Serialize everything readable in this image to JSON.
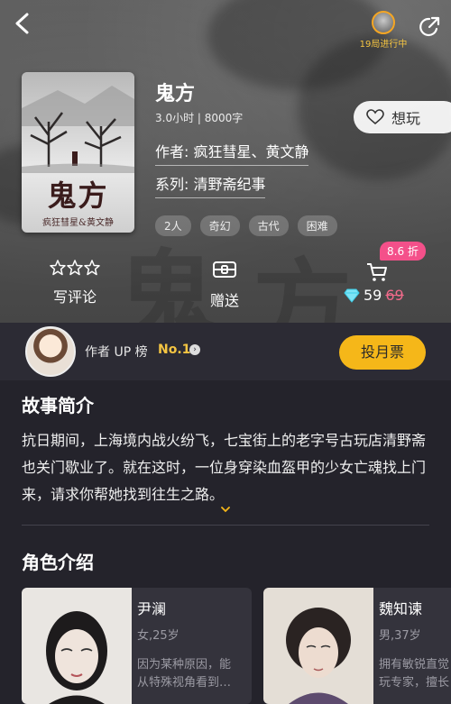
{
  "header": {
    "progress_text": "19局进行中"
  },
  "book": {
    "cover_title": "鬼方",
    "cover_authors": "疯狂彗星&黄文静",
    "title": "鬼方",
    "meta": "3.0小时 | 8000字",
    "author_line": "作者: 疯狂彗星、黄文静",
    "series_line": "系列: 清野斋纪事",
    "want_label": "想玩",
    "tags": [
      "2人",
      "奇幻",
      "古代",
      "困难"
    ]
  },
  "actions": {
    "review_label": "写评论",
    "gift_label": "赠送",
    "discount_badge": "8.6 折",
    "price_current": "59",
    "price_original": "69"
  },
  "up": {
    "label": "作者 UP 榜",
    "rank": "No.1",
    "vote_label": "投月票"
  },
  "story": {
    "heading": "故事简介",
    "text": "抗日期间，上海境内战火纷飞，七宝街上的老字号古玩店清野斋也关门歇业了。就在这时，一位身穿染血盔甲的少女亡魂找上门来，请求你帮她找到往生之路。"
  },
  "characters": {
    "heading": "角色介绍",
    "items": [
      {
        "name": "尹澜",
        "meta": "女,25岁",
        "desc1": "因为某种原因，能",
        "desc2": "从特殊视角看到…"
      },
      {
        "name": "魏知谏",
        "meta": "男,37岁",
        "desc1": "拥有敏锐直觉",
        "desc2": "玩专家，擅长"
      }
    ]
  },
  "colors": {
    "accent_gold": "#f5b719",
    "discount_pink": "#f4508a",
    "background": "#24232b"
  }
}
